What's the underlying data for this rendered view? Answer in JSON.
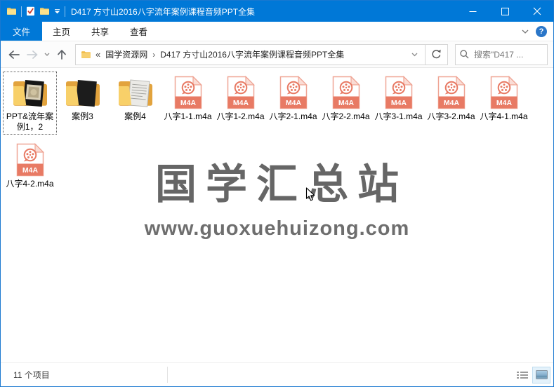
{
  "window": {
    "title": "D417 方寸山2016八字流年案例课程音频PPT全集"
  },
  "menu": {
    "tabs": [
      {
        "label": "文件",
        "active": true
      },
      {
        "label": "主页",
        "active": false
      },
      {
        "label": "共享",
        "active": false
      },
      {
        "label": "查看",
        "active": false
      }
    ]
  },
  "toolbar": {
    "breadcrumb": {
      "overflow_indicator": "«",
      "separator": "›",
      "items": [
        "国学资源网",
        "D417 方寸山2016八字流年案例课程音频PPT全集"
      ]
    },
    "search_placeholder": "搜索\"D417 ..."
  },
  "content": {
    "file_badge": "M4A",
    "items": [
      {
        "kind": "folder",
        "preview": "ppt",
        "label": "PPT&流年案例1，2",
        "selected": true
      },
      {
        "kind": "folder",
        "preview": "stripes",
        "label": "案例3",
        "selected": false
      },
      {
        "kind": "folder",
        "preview": "docs",
        "label": "案例4",
        "selected": false
      },
      {
        "kind": "m4a",
        "label": "八字1-1.m4a",
        "selected": false
      },
      {
        "kind": "m4a",
        "label": "八字1-2.m4a",
        "selected": false
      },
      {
        "kind": "m4a",
        "label": "八字2-1.m4a",
        "selected": false
      },
      {
        "kind": "m4a",
        "label": "八字2-2.m4a",
        "selected": false
      },
      {
        "kind": "m4a",
        "label": "八字3-1.m4a",
        "selected": false
      },
      {
        "kind": "m4a",
        "label": "八字3-2.m4a",
        "selected": false
      },
      {
        "kind": "m4a",
        "label": "八字4-1.m4a",
        "selected": false
      },
      {
        "kind": "m4a",
        "label": "八字4-2.m4a",
        "selected": false
      }
    ],
    "watermark": {
      "title": "国学汇总站",
      "url": "www.guoxuehuizong.com"
    }
  },
  "statusbar": {
    "items_count": "11 个项目"
  },
  "colors": {
    "accent": "#0078d7",
    "m4a_red": "#e87a64",
    "folder_front": "#f8d069",
    "folder_back": "#e2a33d"
  }
}
